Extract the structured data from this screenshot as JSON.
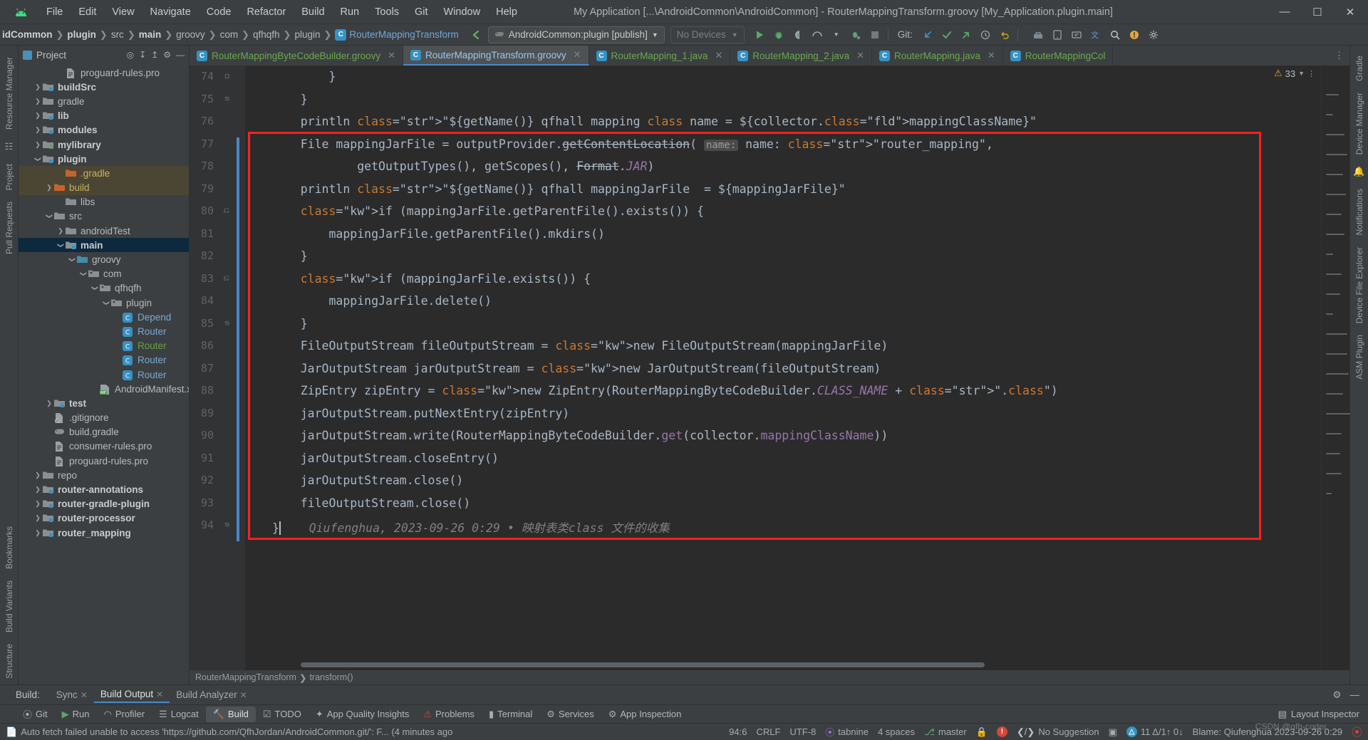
{
  "window": {
    "title": "My Application [...\\AndroidCommon\\AndroidCommon] - RouterMappingTransform.groovy [My_Application.plugin.main]",
    "logo_icon": "android-logo-icon",
    "minimize_icon": "minimize-icon",
    "maximize_icon": "maximize-icon",
    "close_icon": "close-icon"
  },
  "menu": [
    {
      "label": "File"
    },
    {
      "label": "Edit"
    },
    {
      "label": "View"
    },
    {
      "label": "Navigate"
    },
    {
      "label": "Code"
    },
    {
      "label": "Refactor"
    },
    {
      "label": "Build"
    },
    {
      "label": "Run"
    },
    {
      "label": "Tools"
    },
    {
      "label": "Git"
    },
    {
      "label": "Window"
    },
    {
      "label": "Help"
    }
  ],
  "navbar": {
    "breadcrumbs": [
      {
        "label": "idCommon",
        "style": "bold"
      },
      {
        "label": "plugin",
        "style": "bold"
      },
      {
        "label": "src",
        "style": "normal"
      },
      {
        "label": "main",
        "style": "bold"
      },
      {
        "label": "groovy",
        "style": "normal"
      },
      {
        "label": "com",
        "style": "normal"
      },
      {
        "label": "qfhqfh",
        "style": "normal"
      },
      {
        "label": "plugin",
        "style": "normal"
      },
      {
        "label": "RouterMappingTransform",
        "style": "link",
        "icon": "class-icon"
      }
    ],
    "run_config": "AndroidCommon:plugin [publish]",
    "run_config_icon": "gradle-elephant-icon",
    "devices": "No Devices",
    "git_label": "Git:",
    "icons": [
      "run-icon",
      "debug-icon",
      "coverage-icon",
      "profiler-icon",
      "dropdown-icon",
      "attach-debugger-icon",
      "stop-icon",
      "git-update-icon",
      "git-commit-icon",
      "git-push-icon",
      "history-icon",
      "undo-icon",
      "build-icon",
      "avd-manager-icon",
      "sdk-manager-icon",
      "translate-icon",
      "search-icon",
      "notifications-icon",
      "settings-icon"
    ]
  },
  "left_strip": {
    "items": [
      "Resource Manager",
      "Project",
      "Pull Requests"
    ],
    "bottom_items": [
      "Bookmarks",
      "Build Variants",
      "Structure"
    ]
  },
  "right_strip": {
    "items": [
      "Gradle",
      "Device Manager",
      "Notifications",
      "Device File Explorer",
      "ASM Plugin"
    ]
  },
  "project_panel": {
    "title": "Project",
    "header_icons": [
      "locate-icon",
      "collapse-all-icon",
      "expand-all-icon",
      "settings-icon",
      "hide-icon"
    ],
    "tree": [
      {
        "label": "proguard-rules.pro",
        "depth": 3,
        "arrow": "",
        "icon": "file-pro-icon",
        "style": "normal"
      },
      {
        "label": "buildSrc",
        "depth": 1,
        "arrow": "collapsed",
        "icon": "module-folder-icon",
        "style": "bold"
      },
      {
        "label": "gradle",
        "depth": 1,
        "arrow": "collapsed",
        "icon": "folder-icon",
        "style": "normal"
      },
      {
        "label": "lib",
        "depth": 1,
        "arrow": "collapsed",
        "icon": "module-folder-icon",
        "style": "bold"
      },
      {
        "label": "modules",
        "depth": 1,
        "arrow": "collapsed",
        "icon": "module-folder-icon",
        "style": "bold"
      },
      {
        "label": "mylibrary",
        "depth": 1,
        "arrow": "collapsed",
        "icon": "library-folder-icon",
        "style": "bold"
      },
      {
        "label": "plugin",
        "depth": 1,
        "arrow": "expanded",
        "icon": "module-folder-icon",
        "style": "bold"
      },
      {
        "label": ".gradle",
        "depth": 3,
        "arrow": "",
        "icon": "excluded-folder-icon",
        "style": "orange",
        "row": "highlight"
      },
      {
        "label": "build",
        "depth": 2,
        "arrow": "collapsed",
        "icon": "excluded-folder-icon",
        "style": "orange",
        "row": "highlight"
      },
      {
        "label": "libs",
        "depth": 3,
        "arrow": "",
        "icon": "folder-icon",
        "style": "normal"
      },
      {
        "label": "src",
        "depth": 2,
        "arrow": "expanded",
        "icon": "folder-icon",
        "style": "normal"
      },
      {
        "label": "androidTest",
        "depth": 3,
        "arrow": "collapsed",
        "icon": "folder-icon",
        "style": "normal"
      },
      {
        "label": "main",
        "depth": 3,
        "arrow": "expanded",
        "icon": "module-folder-icon",
        "style": "bold",
        "row": "selected"
      },
      {
        "label": "groovy",
        "depth": 4,
        "arrow": "expanded",
        "icon": "source-folder-icon",
        "style": "normal"
      },
      {
        "label": "com",
        "depth": 5,
        "arrow": "expanded",
        "icon": "package-icon",
        "style": "normal"
      },
      {
        "label": "qfhqfh",
        "depth": 6,
        "arrow": "expanded",
        "icon": "package-icon",
        "style": "normal"
      },
      {
        "label": "plugin",
        "depth": 7,
        "arrow": "expanded",
        "icon": "package-icon",
        "style": "normal"
      },
      {
        "label": "Depend",
        "depth": 8,
        "arrow": "",
        "icon": "class-icon",
        "style": "blue"
      },
      {
        "label": "Router",
        "depth": 8,
        "arrow": "",
        "icon": "class-icon",
        "style": "blue"
      },
      {
        "label": "Router",
        "depth": 8,
        "arrow": "",
        "icon": "class-icon",
        "style": "green"
      },
      {
        "label": "Router",
        "depth": 8,
        "arrow": "",
        "icon": "class-icon",
        "style": "blue"
      },
      {
        "label": "Router",
        "depth": 8,
        "arrow": "",
        "icon": "class-icon",
        "style": "blue"
      },
      {
        "label": "AndroidManifest.xm",
        "depth": 6,
        "arrow": "",
        "icon": "manifest-icon",
        "style": "normal"
      },
      {
        "label": "test",
        "depth": 2,
        "arrow": "collapsed",
        "icon": "module-folder-icon",
        "style": "bold"
      },
      {
        "label": ".gitignore",
        "depth": 2,
        "arrow": "",
        "icon": "gitignore-icon",
        "style": "normal"
      },
      {
        "label": "build.gradle",
        "depth": 2,
        "arrow": "",
        "icon": "gradle-elephant-icon",
        "style": "normal"
      },
      {
        "label": "consumer-rules.pro",
        "depth": 2,
        "arrow": "",
        "icon": "file-pro-icon",
        "style": "normal"
      },
      {
        "label": "proguard-rules.pro",
        "depth": 2,
        "arrow": "",
        "icon": "file-pro-icon",
        "style": "normal"
      },
      {
        "label": "repo",
        "depth": 1,
        "arrow": "collapsed",
        "icon": "folder-icon",
        "style": "normal"
      },
      {
        "label": "router-annotations",
        "depth": 1,
        "arrow": "collapsed",
        "icon": "module-folder-icon",
        "style": "bold"
      },
      {
        "label": "router-gradle-plugin",
        "depth": 1,
        "arrow": "collapsed",
        "icon": "module-folder-icon",
        "style": "bold"
      },
      {
        "label": "router-processor",
        "depth": 1,
        "arrow": "collapsed",
        "icon": "module-folder-icon",
        "style": "bold"
      },
      {
        "label": "router_mapping",
        "depth": 1,
        "arrow": "collapsed",
        "icon": "module-folder-icon",
        "style": "bold"
      }
    ]
  },
  "editor": {
    "tabs": [
      {
        "label": "RouterMappingByteCodeBuilder.groovy",
        "active": false,
        "icon": "class-icon"
      },
      {
        "label": "RouterMappingTransform.groovy",
        "active": true,
        "icon": "class-icon"
      },
      {
        "label": "RouterMapping_1.java",
        "active": false,
        "icon": "class-icon"
      },
      {
        "label": "RouterMapping_2.java",
        "active": false,
        "icon": "class-icon"
      },
      {
        "label": "RouterMapping.java",
        "active": false,
        "icon": "class-icon"
      },
      {
        "label": "RouterMappingCol",
        "active": false,
        "icon": "class-icon"
      }
    ],
    "warning_count": "33",
    "warning_icon": "warning-triangle-icon",
    "first_line_number": 74,
    "lines": [
      {
        "num": 74,
        "fold": "minus"
      },
      {
        "num": 75,
        "fold": "end"
      },
      {
        "num": 76,
        "fold": ""
      },
      {
        "num": 77,
        "fold": ""
      },
      {
        "num": 78,
        "fold": ""
      },
      {
        "num": 79,
        "fold": ""
      },
      {
        "num": 80,
        "fold": "start"
      },
      {
        "num": 81,
        "fold": ""
      },
      {
        "num": 82,
        "fold": ""
      },
      {
        "num": 83,
        "fold": "start"
      },
      {
        "num": 84,
        "fold": ""
      },
      {
        "num": 85,
        "fold": "end"
      },
      {
        "num": 86,
        "fold": ""
      },
      {
        "num": 87,
        "fold": ""
      },
      {
        "num": 88,
        "fold": ""
      },
      {
        "num": 89,
        "fold": ""
      },
      {
        "num": 90,
        "fold": ""
      },
      {
        "num": 91,
        "fold": ""
      },
      {
        "num": 92,
        "fold": ""
      },
      {
        "num": 93,
        "fold": ""
      },
      {
        "num": 94,
        "fold": "end"
      }
    ],
    "code_text": [
      "        }",
      "    }",
      "    println \"${getName()} qfhall mapping class name = ${collector.mappingClassName}\"",
      "    File mappingJarFile = outputProvider.getContentLocation( name: \"router_mapping\",",
      "            getOutputTypes(), getScopes(), Format.JAR)",
      "    println \"${getName()} qfhall mappingJarFile  = ${mappingJarFile}\"",
      "    if (mappingJarFile.getParentFile().exists()) {",
      "        mappingJarFile.getParentFile().mkdirs()",
      "    }",
      "    if (mappingJarFile.exists()) {",
      "        mappingJarFile.delete()",
      "    }",
      "    FileOutputStream fileOutputStream = new FileOutputStream(mappingJarFile)",
      "    JarOutputStream jarOutputStream = new JarOutputStream(fileOutputStream)",
      "    ZipEntry zipEntry = new ZipEntry(RouterMappingByteCodeBuilder.CLASS_NAME + \".class\")",
      "    jarOutputStream.putNextEntry(zipEntry)",
      "    jarOutputStream.write(RouterMappingByteCodeBuilder.get(collector.mappingClassName))",
      "    jarOutputStream.closeEntry()",
      "    jarOutputStream.close()",
      "    fileOutputStream.close()",
      "}"
    ],
    "inline_comment": "Qiufenghua, 2023-09-26 0:29 • 映射表类class 文件的收集",
    "param_hint": "name:",
    "annotation_color": "#ff1f1f",
    "bottom_breadcrumb": [
      "RouterMappingTransform",
      "transform()"
    ]
  },
  "build_panel": {
    "title": "Build:",
    "tabs": [
      {
        "label": "Sync",
        "active": false
      },
      {
        "label": "Build Output",
        "active": true
      },
      {
        "label": "Build Analyzer",
        "active": false
      }
    ],
    "right_icons": [
      "settings-icon",
      "minimize-icon"
    ]
  },
  "bottom_tabs": [
    {
      "label": "Git",
      "icon": "git-icon",
      "active": false
    },
    {
      "label": "Run",
      "icon": "run-icon",
      "active": false
    },
    {
      "label": "Profiler",
      "icon": "profiler-icon",
      "active": false
    },
    {
      "label": "Logcat",
      "icon": "logcat-icon",
      "active": false
    },
    {
      "label": "Build",
      "icon": "build-hammer-icon",
      "active": true
    },
    {
      "label": "TODO",
      "icon": "todo-icon",
      "active": false
    },
    {
      "label": "App Quality Insights",
      "icon": "insights-icon",
      "active": false
    },
    {
      "label": "Problems",
      "icon": "problems-icon",
      "active": false
    },
    {
      "label": "Terminal",
      "icon": "terminal-icon",
      "active": false
    },
    {
      "label": "Services",
      "icon": "services-icon",
      "active": false
    },
    {
      "label": "App Inspection",
      "icon": "inspection-icon",
      "active": false
    }
  ],
  "bottom_right": {
    "label": "Layout Inspector",
    "icon": "layout-inspector-icon"
  },
  "statusbar": {
    "message": "Auto fetch failed unable to access 'https://github.com/QfhJordan/AndroidCommon.git/': F... (4 minutes ago",
    "message_icon": "info-icon",
    "caret_position": "94:6",
    "line_separator": "CRLF",
    "encoding": "UTF-8",
    "tabnine": "tabnine",
    "indent": "4 spaces",
    "branch": "master",
    "branch_icon": "git-branch-icon",
    "lock_icon": "lock-icon",
    "error_badge": "!",
    "suggestion": "No Suggestion",
    "suggestion_icon": "code-suggestion-icon",
    "inspection_icon": "inspection-badge-icon",
    "diff_icon": "diff-triangle-icon",
    "diff_counts": "11 Δ/1↑ 0↓",
    "blame": "Blame: Qiufenghua 2023-09-26 0:29",
    "watermark": "CSDN @qfh-coder"
  },
  "colors": {
    "accent": "#4a88c7",
    "annotation": "#ff1f1f",
    "panel_bg": "#3c3f41",
    "editor_bg": "#2b2b2b",
    "gutter_bg": "#313335",
    "selection": "#0d293e",
    "highlight": "#4b4634",
    "string": "#6a8759",
    "keyword": "#cc7832",
    "field": "#9876aa",
    "text": "#a9b7c6"
  }
}
